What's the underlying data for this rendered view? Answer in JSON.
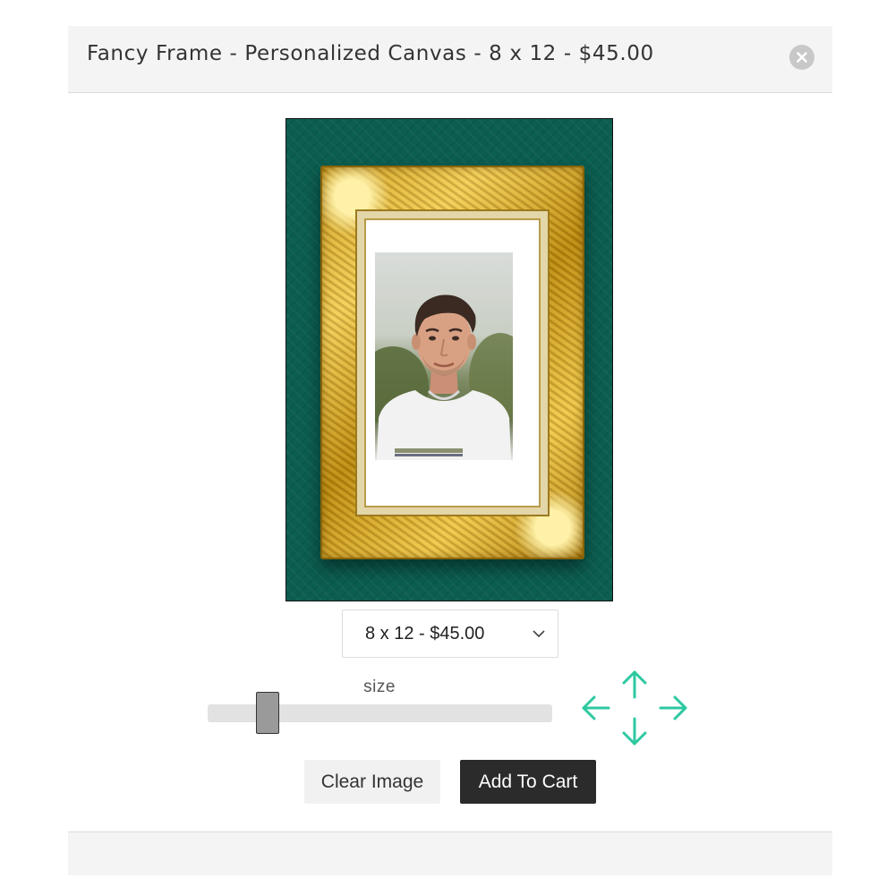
{
  "modal": {
    "title": "Fancy Frame - Personalized Canvas - 8 x 12 - $45.00"
  },
  "icons": {
    "close": "close-circle-icon",
    "chevron": "chevron-down-icon",
    "move_up": "arrow-up-icon",
    "move_down": "arrow-down-icon",
    "move_left": "arrow-left-icon",
    "move_right": "arrow-right-icon"
  },
  "colors": {
    "canvas_background": "#0b5e50",
    "frame_gold": "#d4a52a",
    "arrow_accent": "#2dc9a0",
    "primary_button": "#2b2b2b"
  },
  "size_select": {
    "selected": "8 x 12 - $45.00"
  },
  "size_slider": {
    "label": "size",
    "value_fraction": 0.15
  },
  "buttons": {
    "clear_image": "Clear Image",
    "add_to_cart": "Add To Cart"
  }
}
